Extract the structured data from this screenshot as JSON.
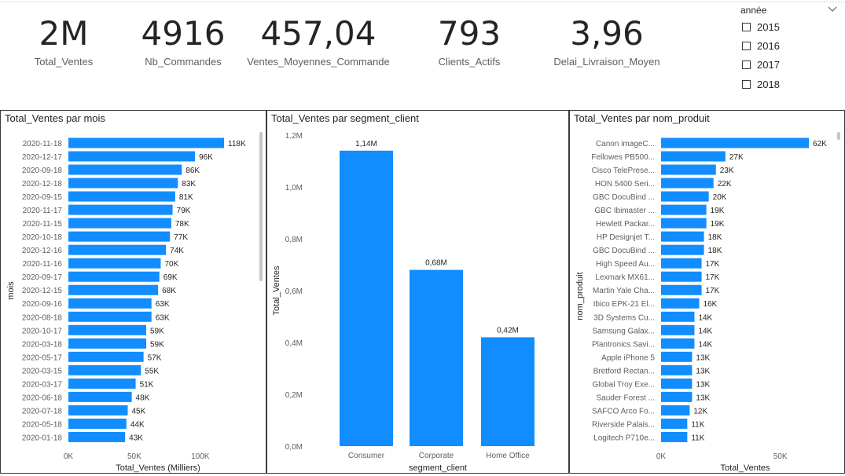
{
  "kpis": [
    {
      "value": "2M",
      "label": "Total_Ventes"
    },
    {
      "value": "4916",
      "label": "Nb_Commandes"
    },
    {
      "value": "457,04",
      "label": "Ventes_Moyennes_Commande"
    },
    {
      "value": "793",
      "label": "Clients_Actifs"
    },
    {
      "value": "3,96",
      "label": "Delai_Livraison_Moyen"
    }
  ],
  "slicer": {
    "title": "année",
    "options": [
      "2015",
      "2016",
      "2017",
      "2018"
    ]
  },
  "colors": {
    "bar": "#118DFF",
    "axis_text": "#605e5c",
    "border": "#3b3a39"
  },
  "icons": {
    "dropdown": "chevron-down-icon",
    "checkbox": "checkbox-icon",
    "scrollbar": "scrollbar-thumb"
  },
  "chart_data": [
    {
      "type": "bar",
      "orientation": "horizontal",
      "title": "Total_Ventes par mois",
      "xlabel": "Total_Ventes (Milliers)",
      "ylabel": "mois",
      "xlim": [
        0,
        118
      ],
      "xticks": [
        "0K",
        "50K",
        "100K"
      ],
      "xtick_values": [
        0,
        50,
        100
      ],
      "categories": [
        "2020-11-18",
        "2020-12-17",
        "2020-09-18",
        "2020-12-18",
        "2020-09-15",
        "2020-11-17",
        "2020-11-15",
        "2020-10-18",
        "2020-12-16",
        "2020-11-16",
        "2020-09-17",
        "2020-12-15",
        "2020-09-16",
        "2020-08-18",
        "2020-10-17",
        "2020-03-18",
        "2020-05-17",
        "2020-03-15",
        "2020-03-17",
        "2020-06-18",
        "2020-07-18",
        "2020-05-18",
        "2020-01-18"
      ],
      "values": [
        118,
        96,
        86,
        83,
        81,
        79,
        78,
        77,
        74,
        70,
        69,
        68,
        63,
        63,
        59,
        59,
        57,
        55,
        51,
        48,
        45,
        44,
        43
      ],
      "labels": [
        "118K",
        "96K",
        "86K",
        "83K",
        "81K",
        "79K",
        "78K",
        "77K",
        "74K",
        "70K",
        "69K",
        "68K",
        "63K",
        "63K",
        "59K",
        "59K",
        "57K",
        "55K",
        "51K",
        "48K",
        "45K",
        "44K",
        "43K"
      ]
    },
    {
      "type": "bar",
      "orientation": "vertical",
      "title": "Total_Ventes par segment_client",
      "xlabel": "segment_client",
      "ylabel": "Total_Ventes",
      "ylim": [
        0,
        1.2
      ],
      "yticks": [
        "0,0M",
        "0,2M",
        "0,4M",
        "0,6M",
        "0,8M",
        "1,0M",
        "1,2M"
      ],
      "ytick_values": [
        0,
        0.2,
        0.4,
        0.6,
        0.8,
        1.0,
        1.2
      ],
      "categories": [
        "Consumer",
        "Corporate",
        "Home Office"
      ],
      "values": [
        1.14,
        0.68,
        0.42
      ],
      "labels": [
        "1,14M",
        "0,68M",
        "0,42M"
      ]
    },
    {
      "type": "bar",
      "orientation": "horizontal",
      "title": "Total_Ventes par nom_produit",
      "xlabel": "Total_Ventes",
      "ylabel": "nom_produit",
      "xlim": [
        0,
        62
      ],
      "xticks": [
        "0K",
        "50K"
      ],
      "xtick_values": [
        0,
        50
      ],
      "categories": [
        "Canon imageC...",
        "Fellowes PB500...",
        "Cisco TelePrese...",
        "HON 5400 Seri...",
        "GBC DocuBind ...",
        "GBC Ibimaster ...",
        "Hewlett Packar...",
        "HP Designjet T...",
        "GBC DocuBind ...",
        "High Speed Au...",
        "Lexmark MX61...",
        "Martin Yale Cha...",
        "Ibico EPK-21 El...",
        "3D Systems Cu...",
        "Samsung Galax...",
        "Plantronics Savi...",
        "Apple iPhone 5",
        "Bretford Rectan...",
        "Global Troy Exe...",
        "Sauder Forest ...",
        "SAFCO Arco Fo...",
        "Riverside Palais...",
        "Logitech P710e..."
      ],
      "values": [
        62,
        27,
        23,
        22,
        20,
        19,
        19,
        18,
        18,
        17,
        17,
        17,
        16,
        14,
        14,
        14,
        13,
        13,
        13,
        13,
        12,
        11,
        11
      ],
      "labels": [
        "62K",
        "27K",
        "23K",
        "22K",
        "20K",
        "19K",
        "19K",
        "18K",
        "18K",
        "17K",
        "17K",
        "17K",
        "16K",
        "14K",
        "14K",
        "14K",
        "13K",
        "13K",
        "13K",
        "13K",
        "12K",
        "11K",
        "11K"
      ]
    }
  ]
}
